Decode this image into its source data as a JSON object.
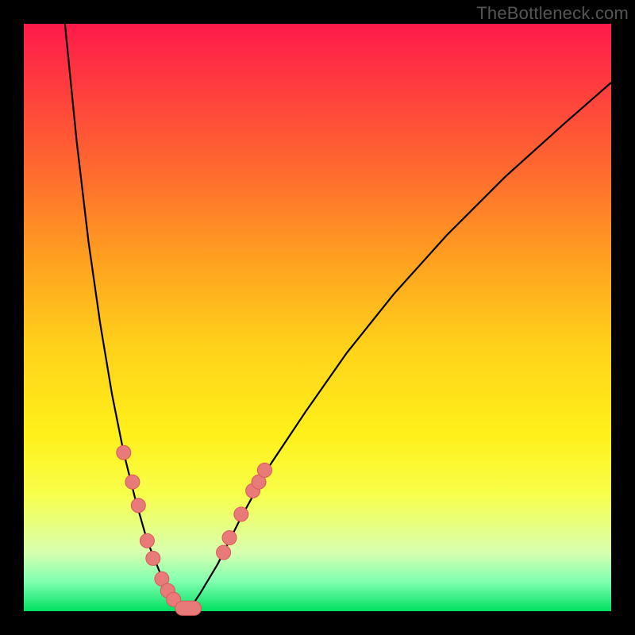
{
  "watermark": "TheBottleneck.com",
  "colors": {
    "dot_fill": "#e97a7a",
    "dot_stroke": "#d85858",
    "curve": "#000000",
    "gradient_top": "#ff1a4b",
    "gradient_bottom": "#00e060"
  },
  "chart_data": {
    "type": "line",
    "title": "",
    "xlabel": "",
    "ylabel": "",
    "xlim": [
      0,
      100
    ],
    "ylim": [
      0,
      100
    ],
    "series": [
      {
        "name": "left-curve",
        "x": [
          7,
          9,
          11,
          13,
          15,
          17,
          19,
          21,
          23,
          25,
          26.5,
          28
        ],
        "values": [
          100,
          80,
          63,
          49,
          37,
          27,
          19,
          12,
          7,
          3,
          1,
          0
        ]
      },
      {
        "name": "right-curve",
        "x": [
          28,
          30,
          33,
          37,
          42,
          48,
          55,
          63,
          72,
          82,
          92,
          100
        ],
        "values": [
          0,
          3,
          8,
          16,
          25,
          34,
          44,
          54,
          64,
          74,
          83,
          90
        ]
      }
    ],
    "markers": [
      {
        "series": "left-curve",
        "points": [
          {
            "x": 17,
            "y": 27
          },
          {
            "x": 18.5,
            "y": 22
          },
          {
            "x": 19.5,
            "y": 18
          },
          {
            "x": 21,
            "y": 12
          },
          {
            "x": 22,
            "y": 9
          },
          {
            "x": 23.5,
            "y": 5.5
          },
          {
            "x": 24.5,
            "y": 3.5
          },
          {
            "x": 25.5,
            "y": 2
          }
        ]
      },
      {
        "series": "right-curve",
        "points": [
          {
            "x": 34,
            "y": 10
          },
          {
            "x": 35,
            "y": 12.5
          },
          {
            "x": 37,
            "y": 16.5
          },
          {
            "x": 39,
            "y": 20.5
          },
          {
            "x": 40,
            "y": 22
          },
          {
            "x": 41,
            "y": 24
          }
        ]
      },
      {
        "series": "minimum-pill",
        "points": [
          {
            "x": 27,
            "y": 0.5
          },
          {
            "x": 29,
            "y": 0.5
          }
        ]
      }
    ],
    "minimum": {
      "x": 28,
      "y": 0
    }
  }
}
